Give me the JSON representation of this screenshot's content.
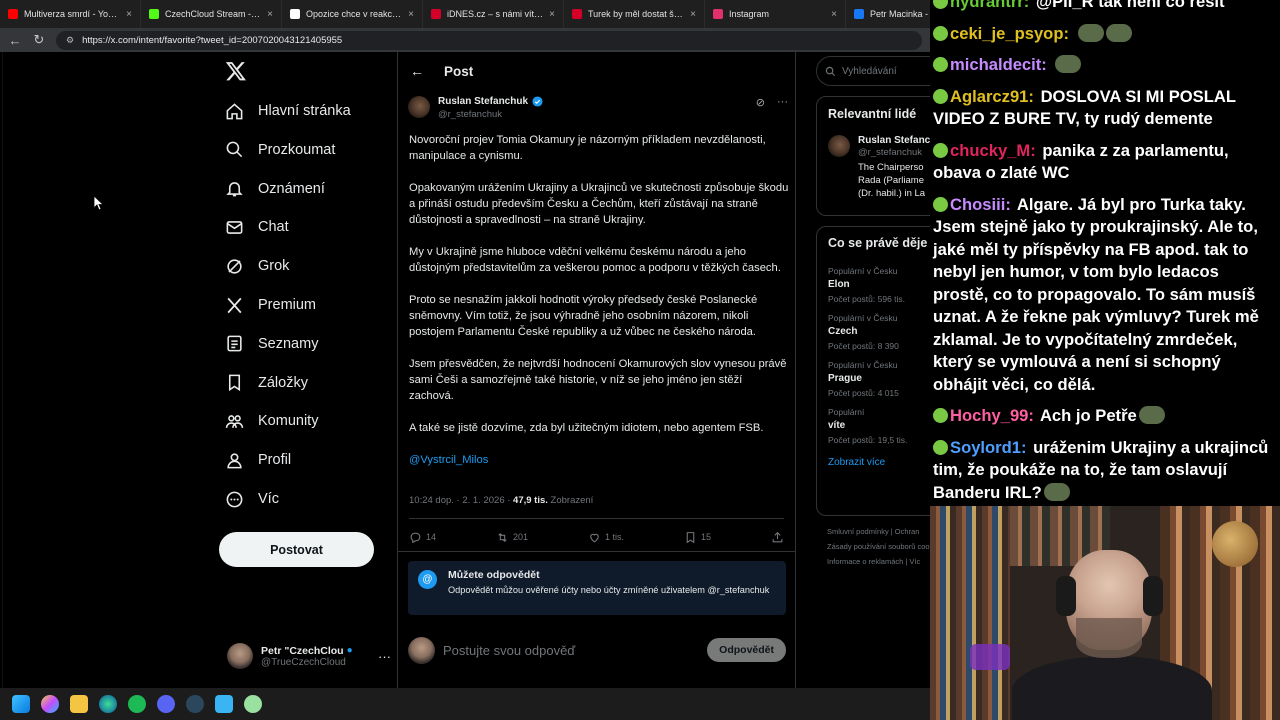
{
  "browser": {
    "tabs": [
      {
        "label": "Multiverza smrdí - YouTube",
        "color": "#ff0000"
      },
      {
        "label": "CzechCloud Stream - Watch L",
        "color": "#53fc18"
      },
      {
        "label": "Opozice chce v reakci na Oka",
        "color": "#ffffff"
      },
      {
        "label": "iDNES.cz – s námi víte víc",
        "color": "#d4002a"
      },
      {
        "label": "Turek by měl dostat šanci, říká",
        "color": "#d4002a"
      },
      {
        "label": "Instagram",
        "color": "#e1306c"
      },
      {
        "label": "Petr Macinka - Fa",
        "color": "#1877f2"
      }
    ],
    "url": "https://x.com/intent/favorite?tweet_id=2007020043121405955"
  },
  "nav": {
    "items": [
      {
        "label": "Hlavní stránka",
        "icon": "home-icon"
      },
      {
        "label": "Prozkoumat",
        "icon": "search-icon"
      },
      {
        "label": "Oznámení",
        "icon": "bell-icon"
      },
      {
        "label": "Chat",
        "icon": "mail-icon"
      },
      {
        "label": "Grok",
        "icon": "grok-icon"
      },
      {
        "label": "Premium",
        "icon": "x-premium-icon"
      },
      {
        "label": "Seznamy",
        "icon": "list-icon"
      },
      {
        "label": "Záložky",
        "icon": "bookmark-icon"
      },
      {
        "label": "Komunity",
        "icon": "communities-icon"
      },
      {
        "label": "Profil",
        "icon": "profile-icon"
      },
      {
        "label": "Víc",
        "icon": "more-circle-icon"
      }
    ],
    "post_button": "Postovat",
    "account": {
      "name": "Petr \"CzechClou",
      "handle": "@TrueCzechCloud"
    }
  },
  "post": {
    "header": "Post",
    "author": {
      "name": "Ruslan Stefanchuk",
      "handle": "@r_stefanchuk"
    },
    "paragraphs": [
      "Novoroční projev Tomia Okamury je názorným příkladem nevzdělanosti, manipulace a cynismu.",
      "Opakovaným urážením Ukrajiny a Ukrajinců ve skutečnosti způsobuje škodu a přináší ostudu především Česku a Čechům, kteří zůstávají na straně důstojnosti a spravedlnosti – na straně Ukrajiny.",
      "My v Ukrajině jsme hluboce vděční velkému českému národu a jeho důstojným představitelům za veškerou pomoc a podporu v těžkých časech.",
      "Proto se nesnažím jakkoli hodnotit výroky předsedy české Poslanecké sněmovny. Vím totiž, že jsou výhradně jeho osobním názorem, nikoli postojem Parlamentu České republiky a už vůbec ne českého národa.",
      "Jsem přesvědčen, že nejtvrdší hodnocení Okamurových slov vynesou právě sami Češi a samozřejmě také historie, v níž se jeho jméno jen stěží zachová.",
      "A také se jistě dozvíme, zda byl užitečným idiotem, nebo agentem FSB."
    ],
    "mention": "@Vystrcil_Milos",
    "time": "10:24 dop. · 2. 1. 2026 ·",
    "views_count": "47,9 tis.",
    "views_label": "Zobrazení",
    "stats": {
      "replies": "14",
      "reposts": "201",
      "likes": "1 tis.",
      "bookmarks": "15"
    },
    "reply_notice": {
      "title": "Můžete odpovědět",
      "text": "Odpovědět můžou ověřené účty nebo účty zmíněné uživatelem @r_stefanchuk"
    },
    "reply_placeholder": "Postujte svou odpověď",
    "reply_button": "Odpovědět"
  },
  "sidebar": {
    "search_placeholder": "Vyhledávání",
    "relevant": {
      "title": "Relevantní lidé",
      "name": "Ruslan Stefanc",
      "handle": "@r_stefanchuk",
      "bio": "The Chairperso\nRada (Parliame\n(Dr. habil.) in La"
    },
    "trends_title": "Co se právě děje",
    "trends": [
      {
        "context": "Populární v Česku",
        "name": "Elon",
        "posts": "Počet postů: 596 tis."
      },
      {
        "context": "Populární v Česku",
        "name": "Czech",
        "posts": "Počet postů: 8 390"
      },
      {
        "context": "Populární v Česku",
        "name": "Prague",
        "posts": "Počet postů: 4 015"
      },
      {
        "context": "Populární",
        "name": "víte",
        "posts": "Počet postů: 19,5 tis."
      }
    ],
    "show_more": "Zobrazit více",
    "footer": [
      "Smluvní podmínky  |  Ochran",
      "Zásady používání souborů coo",
      "Informace o reklamách  |  Víc"
    ]
  },
  "chat": {
    "messages": [
      {
        "user": "hydrantrr:",
        "color": "#66cc33",
        "text": "@PII_R tak není co řešit",
        "emote": false
      },
      {
        "user": "ceki_je_psyop:",
        "color": "#e0c020",
        "text": "",
        "emote": true,
        "emote2": true
      },
      {
        "user": "michaldecit:",
        "color": "#c58bff",
        "text": "",
        "emote": true
      },
      {
        "user": "Aglarcz91:",
        "color": "#e0c020",
        "text": "DOSLOVA SI MI POSLAL VIDEO Z BURE TV, ty rudý demente",
        "emote": false
      },
      {
        "user": "chucky_M:",
        "color": "#e0245e",
        "text": "panika z za parlamentu, obava o zlaté WC",
        "emote": false
      },
      {
        "user": "Chosiii:",
        "color": "#c58bff",
        "text": "Algare. Já byl pro Turka taky. Jsem stejně jako ty proukrajinský. Ale to, jaké měl ty příspěvky na FB apod. tak to nebyl jen humor, v tom bylo ledacos prostě, co to propagovalo. To sám musíš uznat. A že řekne pak výmluvy? Turek mě zklamal. Je to vypočítatelný zmrdeček, který se vymlouvá a není si schopný obhájit věci, co dělá.",
        "emote": false
      },
      {
        "user": "Hochy_99:",
        "color": "#ff5fa2",
        "text": "Ach jo Petře",
        "emote": true
      },
      {
        "user": "Soylord1:",
        "color": "#4f9fff",
        "text": "uráženim Ukrajiny a ukrajinců tim, že poukáže na to, že tam oslavují Banderu IRL?",
        "emote": true
      }
    ]
  }
}
